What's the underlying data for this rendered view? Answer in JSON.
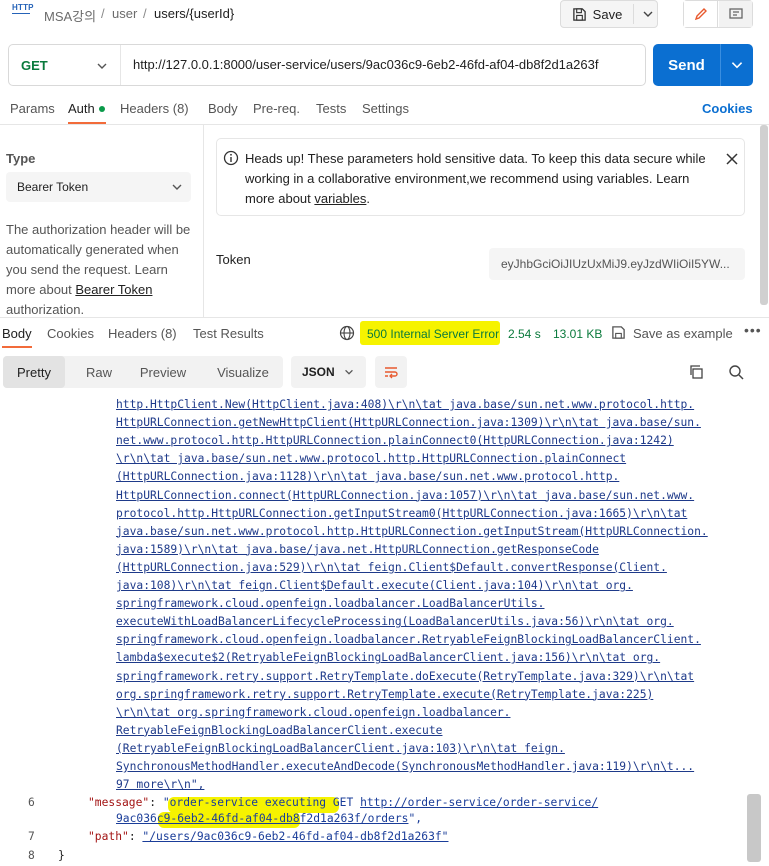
{
  "breadcrumb": {
    "icon_text": "HTTP",
    "items": [
      "MSA강의",
      "user",
      "users/{userId}"
    ],
    "separator": "/"
  },
  "toolbar": {
    "save_label": "Save"
  },
  "request": {
    "method": "GET",
    "url": "http://127.0.0.1:8000/user-service/users/9ac036c9-6eb2-46fd-af04-db8f2d1a263f",
    "send_label": "Send"
  },
  "req_tabs": {
    "params": "Params",
    "auth": "Auth",
    "headers": "Headers (8)",
    "body": "Body",
    "prereq": "Pre-req.",
    "tests": "Tests",
    "settings": "Settings",
    "cookies": "Cookies"
  },
  "auth": {
    "type_label": "Type",
    "type_value": "Bearer Token",
    "desc_before": "The authorization header will be automatically generated when you send the request. Learn more about ",
    "desc_link": "Bearer Token",
    "desc_after": " authorization.",
    "heads_up_before": "Heads up! These parameters hold sensitive data. To keep this data secure while working in a collaborative environment,we recommend using variables. Learn more about ",
    "heads_up_link": "variables",
    "heads_up_after": ".",
    "token_label": "Token",
    "token_value": "eyJhbGciOiJIUzUxMiJ9.eyJzdWIiOiI5YW..."
  },
  "res_tabs": {
    "body": "Body",
    "cookies": "Cookies",
    "headers": "Headers (8)",
    "test_results": "Test Results",
    "status": "500 Internal Server Error",
    "time": "2.54 s",
    "size": "13.01 KB",
    "save_example": "Save as example",
    "more": "•••"
  },
  "response_view": {
    "pretty": "Pretty",
    "raw": "Raw",
    "preview": "Preview",
    "visualize": "Visualize",
    "format": "JSON"
  },
  "code": {
    "trace_lines": [
      "http.HttpClient.New(HttpClient.java:408)\\r\\n\\tat java.base/sun.net.www.protocol.http.",
      "HttpURLConnection.getNewHttpClient(HttpURLConnection.java:1309)\\r\\n\\tat java.base/sun.",
      "net.www.protocol.http.HttpURLConnection.plainConnect0(HttpURLConnection.java:1242)",
      "\\r\\n\\tat java.base/sun.net.www.protocol.http.HttpURLConnection.plainConnect",
      "(HttpURLConnection.java:1128)\\r\\n\\tat java.base/sun.net.www.protocol.http.",
      "HttpURLConnection.connect(HttpURLConnection.java:1057)\\r\\n\\tat java.base/sun.net.www.",
      "protocol.http.HttpURLConnection.getInputStream0(HttpURLConnection.java:1665)\\r\\n\\tat",
      "java.base/sun.net.www.protocol.http.HttpURLConnection.getInputStream(HttpURLConnection.",
      "java:1589)\\r\\n\\tat java.base/java.net.HttpURLConnection.getResponseCode",
      "(HttpURLConnection.java:529)\\r\\n\\tat feign.Client$Default.convertResponse(Client.",
      "java:108)\\r\\n\\tat feign.Client$Default.execute(Client.java:104)\\r\\n\\tat org.",
      "springframework.cloud.openfeign.loadbalancer.LoadBalancerUtils.",
      "executeWithLoadBalancerLifecycleProcessing(LoadBalancerUtils.java:56)\\r\\n\\tat org.",
      "springframework.cloud.openfeign.loadbalancer.RetryableFeignBlockingLoadBalancerClient.",
      "lambda$execute$2(RetryableFeignBlockingLoadBalancerClient.java:156)\\r\\n\\tat org.",
      "springframework.retry.support.RetryTemplate.doExecute(RetryTemplate.java:329)\\r\\n\\tat",
      "org.springframework.retry.support.RetryTemplate.execute(RetryTemplate.java:225)",
      "\\r\\n\\tat org.springframework.cloud.openfeign.loadbalancer.",
      "RetryableFeignBlockingLoadBalancerClient.execute",
      "(RetryableFeignBlockingLoadBalancerClient.java:103)\\r\\n\\tat feign.",
      "SynchronousMethodHandler.executeAndDecode(SynchronousMethodHandler.java:119)\\r\\n\\t...",
      "97 more\\r\\n\","
    ],
    "line6_num": "6",
    "line6_key": "\"message\"",
    "line6_value_a": "\"order-service executing GET ",
    "line6_value_link": "http://order-service/order-service/",
    "line6_value_b": "9ac036c9-6eb2-46fd-af04-db8f2d1a263f/orders",
    "line6_value_c": "\",",
    "line7_num": "7",
    "line7_key": "\"path\"",
    "line7_value": "\"/users/9ac036c9-6eb2-46fd-af04-db8f2d1a263f\"",
    "line8_num": "8",
    "line8_text": "}"
  }
}
